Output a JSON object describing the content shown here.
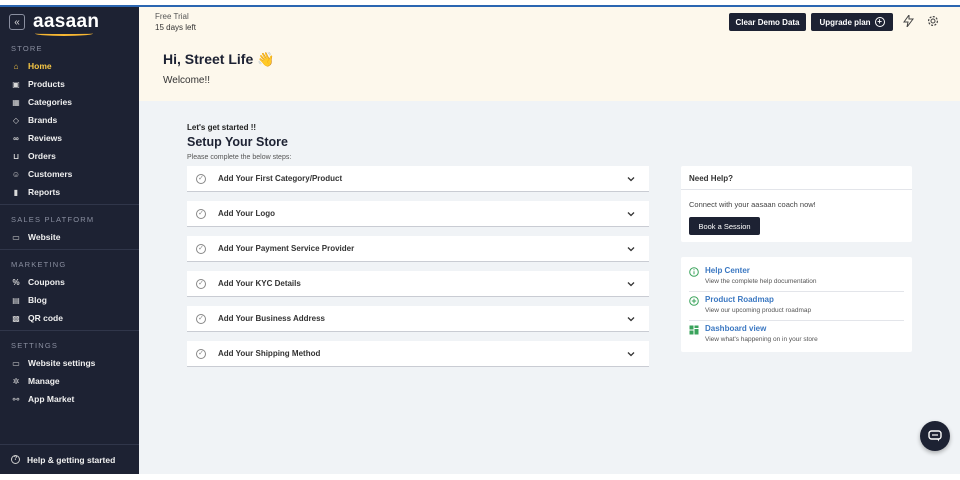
{
  "brand": {
    "name": "aasaan",
    "collapse_glyph": "«"
  },
  "sidebar": {
    "sections": [
      {
        "title": "STORE",
        "items": [
          {
            "label": "Home",
            "icon": "home-icon",
            "glyph": "⌂",
            "active": true
          },
          {
            "label": "Products",
            "icon": "box-icon",
            "glyph": "▣"
          },
          {
            "label": "Categories",
            "icon": "grid-icon",
            "glyph": "▦"
          },
          {
            "label": "Brands",
            "icon": "tag-icon",
            "glyph": "◇"
          },
          {
            "label": "Reviews",
            "icon": "link-icon",
            "glyph": "∞"
          },
          {
            "label": "Orders",
            "icon": "cart-icon",
            "glyph": "⊔"
          },
          {
            "label": "Customers",
            "icon": "users-icon",
            "glyph": "☺"
          },
          {
            "label": "Reports",
            "icon": "bar-chart-icon",
            "glyph": "▮"
          }
        ]
      },
      {
        "title": "SALES PLATFORM",
        "items": [
          {
            "label": "Website",
            "icon": "monitor-icon",
            "glyph": "▭"
          }
        ]
      },
      {
        "title": "MARKETING",
        "items": [
          {
            "label": "Coupons",
            "icon": "percent-icon",
            "glyph": "%"
          },
          {
            "label": "Blog",
            "icon": "blog-icon",
            "glyph": "▤"
          },
          {
            "label": "QR code",
            "icon": "qr-icon",
            "glyph": "▩"
          }
        ]
      },
      {
        "title": "SETTINGS",
        "items": [
          {
            "label": "Website settings",
            "icon": "monitor-gear-icon",
            "glyph": "▭"
          },
          {
            "label": "Manage",
            "icon": "gear-icon",
            "glyph": "✲"
          },
          {
            "label": "App Market",
            "icon": "apps-icon",
            "glyph": "⚯"
          }
        ]
      }
    ],
    "footer": {
      "label": "Help & getting started",
      "icon": "help-circle-icon",
      "glyph": "?"
    }
  },
  "header": {
    "trial_label": "Free Trial",
    "trial_days": "15 days left",
    "clear_button": "Clear Demo Data",
    "upgrade_button": "Upgrade plan",
    "greeting": "Hi, Street Life 👋",
    "welcome": "Welcome!!"
  },
  "setup": {
    "kicker": "Let's get started !!",
    "title": "Setup Your Store",
    "subtitle": "Please complete the below steps:",
    "steps": [
      "Add Your First Category/Product",
      "Add Your Logo",
      "Add Your Payment Service Provider",
      "Add Your KYC Details",
      "Add Your Business Address",
      "Add Your Shipping Method"
    ]
  },
  "help": {
    "title": "Need Help?",
    "text": "Connect with your aasaan coach now!",
    "button": "Book a Session"
  },
  "links": [
    {
      "title": "Help Center",
      "desc": "View the complete help documentation",
      "icon": "info-icon"
    },
    {
      "title": "Product Roadmap",
      "desc": "View our upcoming product roadmap",
      "icon": "plus-circle-icon"
    },
    {
      "title": "Dashboard view",
      "desc": "View what's happening on in your store",
      "icon": "dashboard-icon"
    }
  ],
  "colors": {
    "sidebar": "#1d2233",
    "accent": "#f7c744",
    "link": "#3b78c2",
    "header_bg": "#fdf8ec",
    "main_bg": "#f0f3f6"
  }
}
